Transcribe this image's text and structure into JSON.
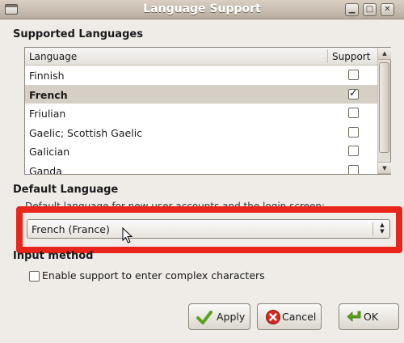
{
  "window": {
    "title": "Language Support",
    "controls": {
      "minimize": "▁",
      "maximize": "□",
      "close": "✕"
    }
  },
  "supported": {
    "heading": "Supported Languages",
    "columns": {
      "language": "Language",
      "support": "Support"
    },
    "rows": [
      {
        "label": "Finnish",
        "checked": false,
        "selected": false
      },
      {
        "label": "French",
        "checked": true,
        "selected": true
      },
      {
        "label": "Friulian",
        "checked": false,
        "selected": false
      },
      {
        "label": "Gaelic; Scottish Gaelic",
        "checked": false,
        "selected": false
      },
      {
        "label": "Galician",
        "checked": false,
        "selected": false
      },
      {
        "label": "Ganda",
        "checked": false,
        "selected": false
      }
    ]
  },
  "default_language": {
    "heading": "Default Language",
    "description": "Default language for new user accounts and the login screen:",
    "selected_value": "French (France)",
    "highlight_color": "#e8251a"
  },
  "input_method": {
    "heading": "Input method",
    "checkbox_label": "Enable support to enter complex characters",
    "checked": false
  },
  "buttons": {
    "apply": "Apply",
    "cancel": "Cancel",
    "ok": "OK"
  },
  "icons": {
    "apply": "check-green-icon",
    "cancel": "cancel-red-icon",
    "ok": "arrow-green-icon"
  }
}
